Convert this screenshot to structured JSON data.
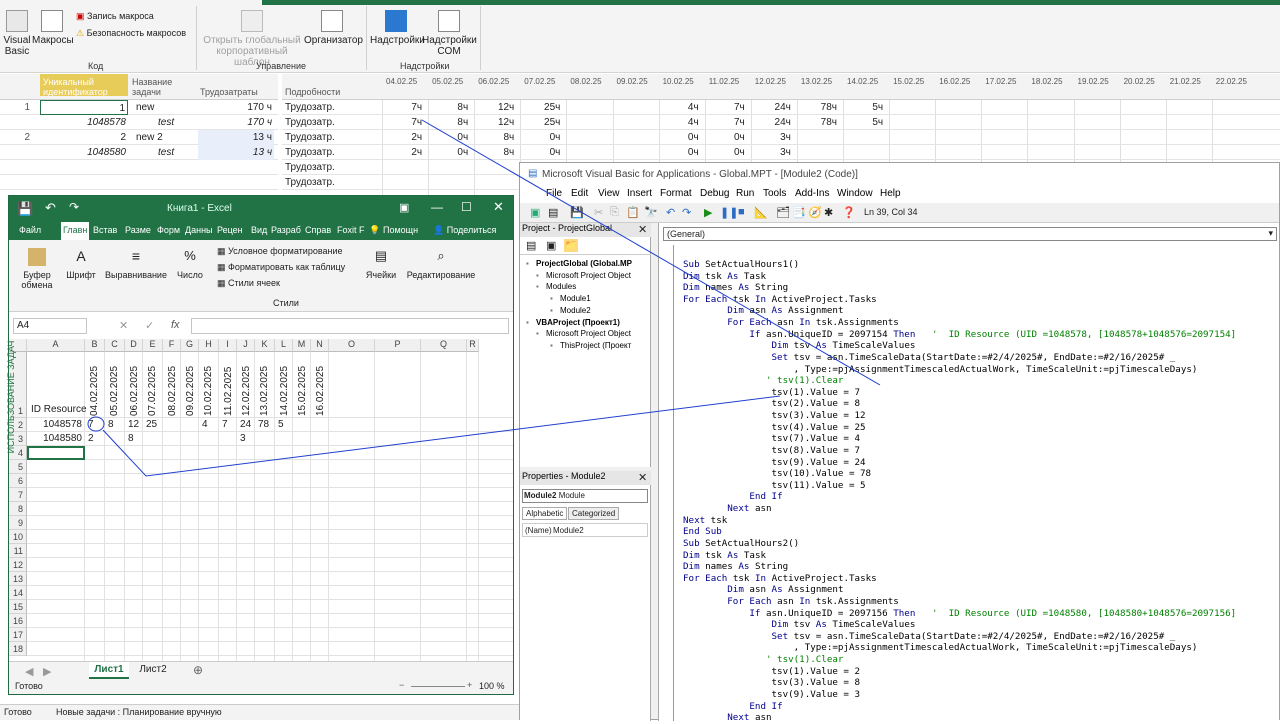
{
  "project_ribbon": {
    "visual_basic_label": "Visual Basic",
    "macros_label": "Макросы",
    "record_macro_label": "Запись макроса",
    "macro_security_label": "Безопасность макросов",
    "code_group_label": "Код",
    "open_global_template_label": "Открыть глобальный корпоративный шаблон",
    "organizer_label": "Организатор",
    "manage_group_label": "Управление",
    "addins_label": "Надстройки",
    "com_addins_label": "Надстройки COM",
    "addins_group_label": "Надстройки"
  },
  "project_grid": {
    "col_uid": "Уникальный идентификатор",
    "col_name": "Название задачи",
    "col_work": "Трудозатраты",
    "col_details": "Подробности",
    "dates": [
      "04.02.25",
      "05.02.25",
      "06.02.25",
      "07.02.25",
      "08.02.25",
      "09.02.25",
      "10.02.25",
      "11.02.25",
      "12.02.25",
      "13.02.25",
      "14.02.25",
      "15.02.25",
      "16.02.25",
      "17.02.25",
      "18.02.25",
      "19.02.25",
      "20.02.25",
      "21.02.25",
      "22.02.25"
    ],
    "rows": [
      {
        "num": "1",
        "uid": "1",
        "name": "new",
        "work": "170 ч",
        "detail": "Трудозатр.",
        "vals": [
          "7ч",
          "8ч",
          "12ч",
          "25ч",
          "",
          "",
          "4ч",
          "7ч",
          "24ч",
          "78ч",
          "5ч"
        ]
      },
      {
        "num": "",
        "uid": "1048578",
        "name": "test",
        "work": "170 ч",
        "detail": "Трудозатр.",
        "vals": [
          "7ч",
          "8ч",
          "12ч",
          "25ч",
          "",
          "",
          "4ч",
          "7ч",
          "24ч",
          "78ч",
          "5ч"
        ]
      },
      {
        "num": "2",
        "uid": "2",
        "name": "new 2",
        "work": "13 ч",
        "detail": "Трудозатр.",
        "vals": [
          "2ч",
          "0ч",
          "8ч",
          "0ч",
          "",
          "",
          "0ч",
          "0ч",
          "3ч",
          "",
          ""
        ]
      },
      {
        "num": "",
        "uid": "1048580",
        "name": "test",
        "work": "13 ч",
        "detail": "Трудозатр.",
        "vals": [
          "2ч",
          "0ч",
          "8ч",
          "0ч",
          "",
          "",
          "0ч",
          "0ч",
          "3ч",
          "",
          ""
        ]
      },
      {
        "num": "",
        "uid": "",
        "name": "",
        "work": "",
        "detail": "Трудозатр.",
        "vals": []
      },
      {
        "num": "",
        "uid": "",
        "name": "",
        "work": "",
        "detail": "Трудозатр.",
        "vals": []
      }
    ],
    "side_label": "ИСПОЛЬЗОВАНИЕ ЗАДАЧ"
  },
  "excel": {
    "title": "Книга1 - Excel",
    "tabs": [
      "Файл",
      "Главн",
      "Встав",
      "Разме",
      "Форм",
      "Данны",
      "Рецен",
      "Вид",
      "Разраб",
      "Справ",
      "Foxit F"
    ],
    "help_label": "Помощн",
    "share_label": "Поделиться",
    "ribbon": {
      "paste": "Буфер обмена",
      "font": "Шрифт",
      "align": "Выравнивание",
      "number": "Число",
      "cond_format": "Условное форматирование",
      "table_format": "Форматировать как таблицу",
      "cell_styles": "Стили ячеек",
      "styles_group": "Стили",
      "cells": "Ячейки",
      "editing": "Редактирование"
    },
    "namebox": "A4",
    "fx": "fx",
    "columns": [
      "A",
      "B",
      "C",
      "D",
      "E",
      "F",
      "G",
      "H",
      "I",
      "J",
      "K",
      "L",
      "M",
      "N",
      "O",
      "P",
      "Q",
      "R"
    ],
    "header_dates": [
      "04.02.2025",
      "05.02.2025",
      "06.02.2025",
      "07.02.2025",
      "08.02.2025",
      "09.02.2025",
      "10.02.2025",
      "11.02.2025",
      "12.02.2025",
      "13.02.2025",
      "14.02.2025",
      "15.02.2025",
      "16.02.2025"
    ],
    "a1": "ID Resource",
    "row2": {
      "id": "1048578",
      "vals": [
        "7",
        "8",
        "12",
        "25",
        "",
        "",
        "4",
        "7",
        "24",
        "78",
        "5",
        "",
        ""
      ]
    },
    "row3": {
      "id": "1048580",
      "vals": [
        "2",
        "",
        "8",
        "",
        "",
        "",
        "",
        "",
        "3",
        "",
        "",
        "",
        ""
      ]
    },
    "row_numbers": [
      "1",
      "2",
      "3",
      "4",
      "5",
      "6",
      "7",
      "8",
      "9",
      "10",
      "11",
      "12",
      "13",
      "14",
      "15",
      "16",
      "17",
      "18"
    ],
    "sheets": [
      "Лист1",
      "Лист2"
    ],
    "status": "Готово",
    "zoom": "100 %"
  },
  "vba": {
    "title": "Microsoft Visual Basic for Applications - Global.MPT - [Module2 (Code)]",
    "menu": [
      "File",
      "Edit",
      "View",
      "Insert",
      "Format",
      "Debug",
      "Run",
      "Tools",
      "Add-Ins",
      "Window",
      "Help"
    ],
    "position": "Ln 39, Col 34",
    "project_title": "Project - ProjectGlobal",
    "tree": [
      "ProjectGlobal (Global.MP",
      "Microsoft Project Object",
      "Modules",
      "Module1",
      "Module2",
      "VBAProject (Проект1)",
      "Microsoft Project Object",
      "ThisProject (Проект"
    ],
    "properties_title": "Properties - Module2",
    "prop_object": "Module2",
    "prop_type": "Module",
    "prop_tabs": [
      "Alphabetic",
      "Categorized"
    ],
    "prop_name_key": "(Name)",
    "prop_name_val": "Module2",
    "general": "(General)",
    "code_lines": [
      "Sub SetActualHours1()",
      "Dim tsk As Task",
      "Dim names As String",
      "For Each tsk In ActiveProject.Tasks",
      "        Dim asn As Assignment",
      "        For Each asn In tsk.Assignments",
      "            If asn.UniqueID = 2097154 Then   '  ID Resource (UID =1048578, [1048578+1048576=2097154]",
      "                Dim tsv As TimeScaleValues",
      "                Set tsv = asn.TimeScaleData(StartDate:=#2/4/2025#, EndDate:=#2/16/2025# _",
      "                    , Type:=pjAssignmentTimescaledActualWork, TimeScaleUnit:=pjTimescaleDays)",
      "               ' tsv(1).Clear",
      "                tsv(1).Value = 7",
      "                tsv(2).Value = 8",
      "                tsv(3).Value = 12",
      "                tsv(4).Value = 25",
      "                tsv(7).Value = 4",
      "                tsv(8).Value = 7",
      "                tsv(9).Value = 24",
      "                tsv(10).Value = 78",
      "                tsv(11).Value = 5",
      "            End If",
      "        Next asn",
      "Next tsk",
      "End Sub",
      "Sub SetActualHours2()",
      "Dim tsk As Task",
      "Dim names As String",
      "For Each tsk In ActiveProject.Tasks",
      "        Dim asn As Assignment",
      "        For Each asn In tsk.Assignments",
      "            If asn.UniqueID = 2097156 Then   '  ID Resource (UID =1048580, [1048580+1048576=2097156]",
      "                Dim tsv As TimeScaleValues",
      "                Set tsv = asn.TimeScaleData(StartDate:=#2/4/2025#, EndDate:=#2/16/2025# _",
      "                    , Type:=pjAssignmentTimescaledActualWork, TimeScaleUnit:=pjTimescaleDays)",
      "               ' tsv(1).Clear",
      "                tsv(1).Value = 2",
      "                tsv(3).Value = 8",
      "                tsv(9).Value = 3",
      "            End If",
      "        Next asn"
    ]
  },
  "statusbar": {
    "ready": "Готово",
    "new_tasks": "Новые задачи : Планирование вручную"
  }
}
